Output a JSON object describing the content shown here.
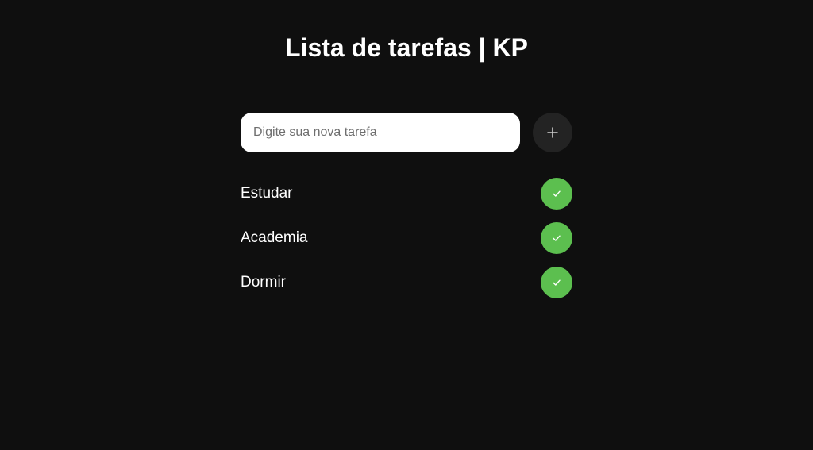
{
  "header": {
    "title": "Lista de tarefas | KP"
  },
  "form": {
    "input_value": "",
    "input_placeholder": "Digite sua nova tarefa",
    "add_icon": "plus-icon"
  },
  "tasks": [
    {
      "label": "Estudar",
      "icon": "check-icon"
    },
    {
      "label": "Academia",
      "icon": "check-icon"
    },
    {
      "label": "Dormir",
      "icon": "check-icon"
    }
  ],
  "colors": {
    "background": "#0f0f0f",
    "add_button": "#232323",
    "done_button": "#5cbf4f",
    "text": "#ffffff"
  }
}
